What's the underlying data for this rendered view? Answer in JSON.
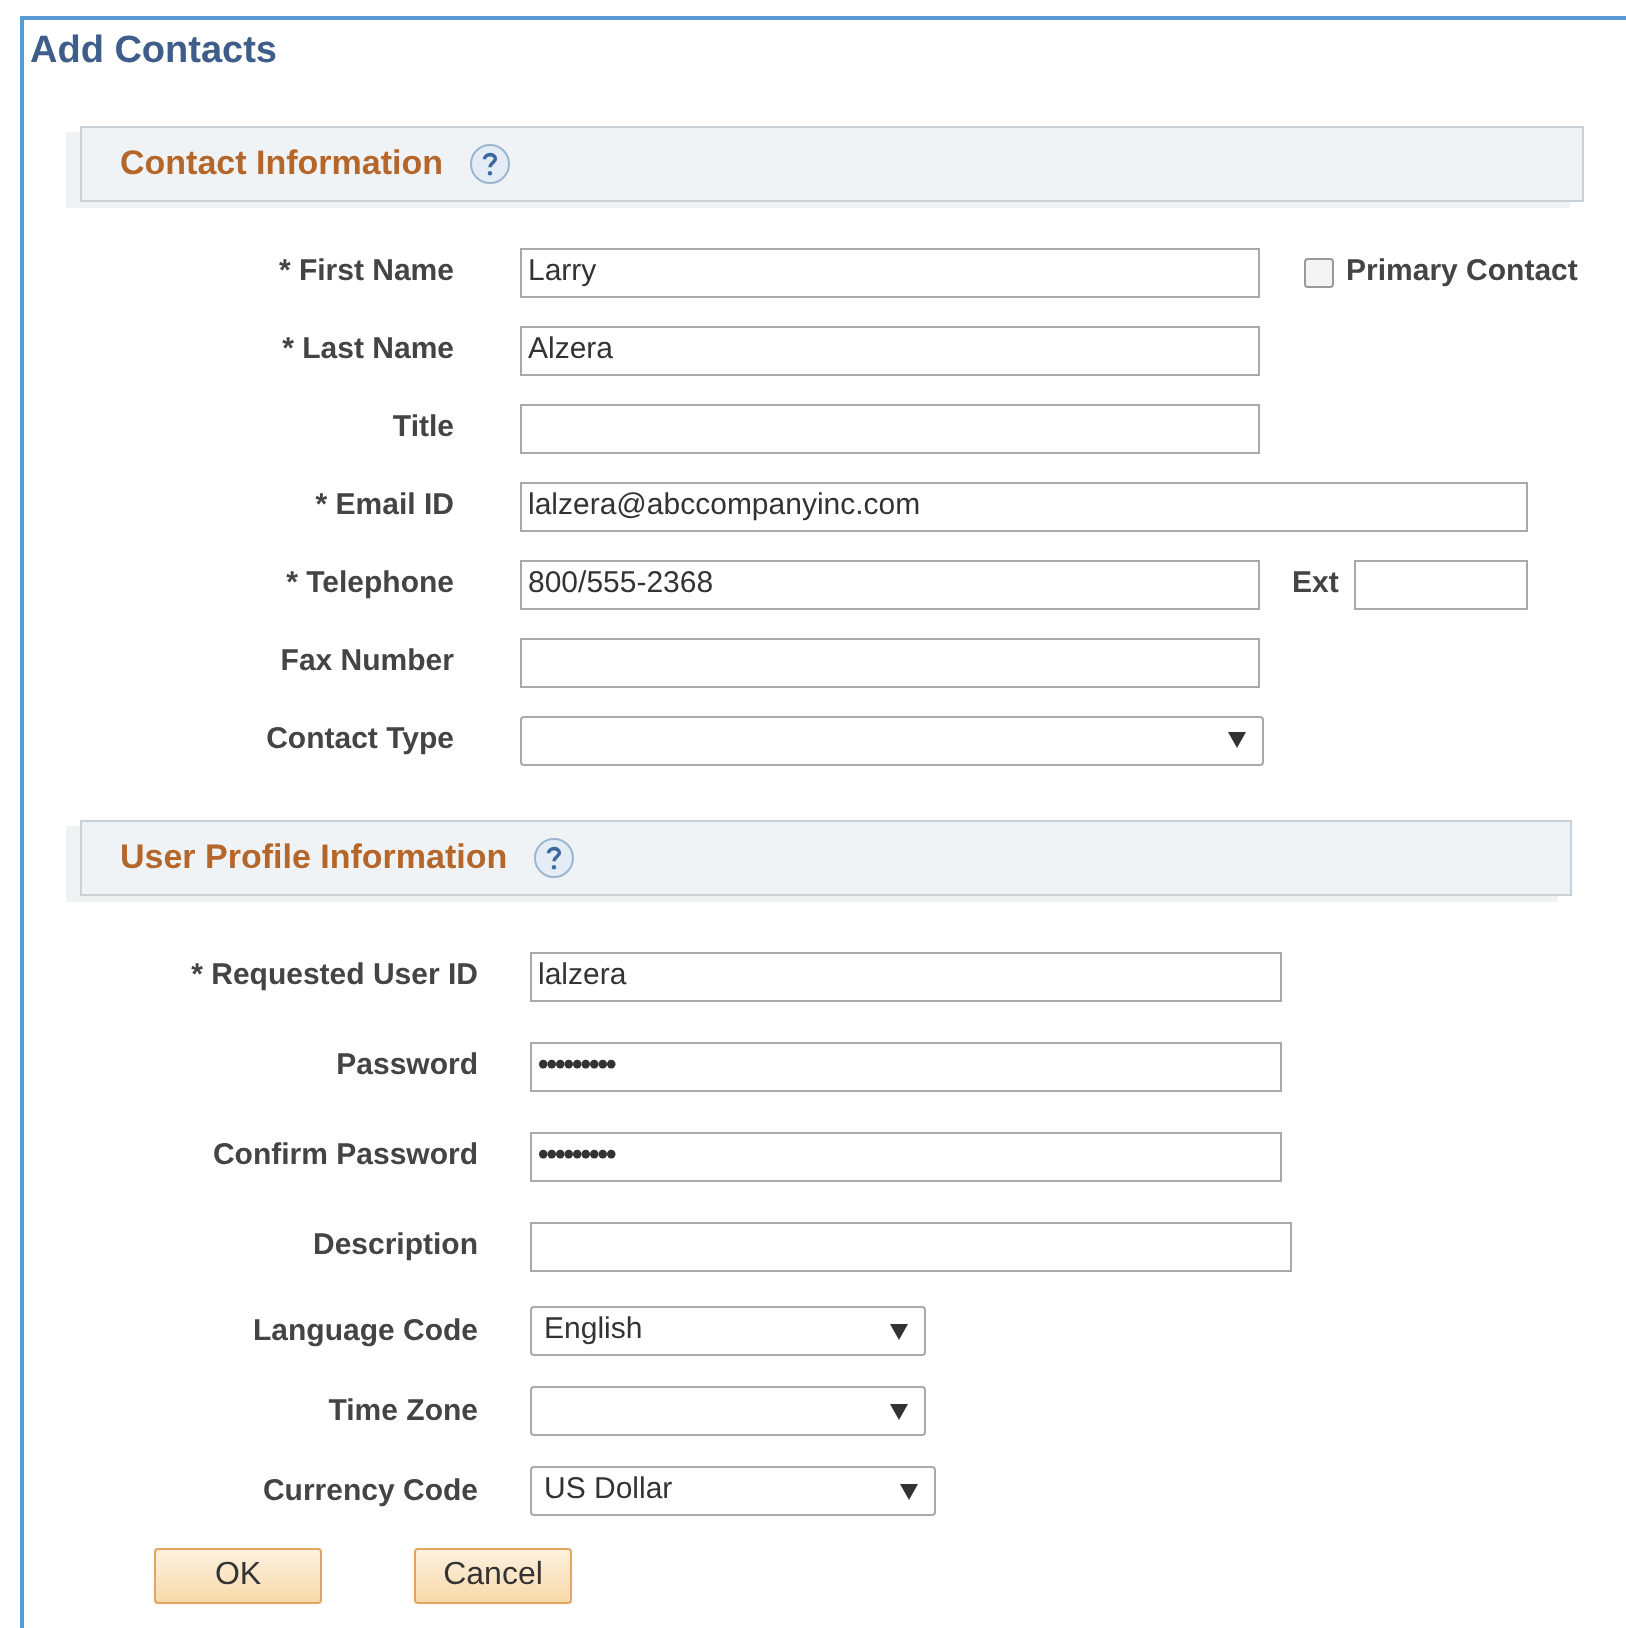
{
  "title": "Add Contacts",
  "sections": [
    {
      "title": "Contact Information",
      "fields": [
        {
          "kind": "text",
          "label": "* First Name",
          "value": "Larry",
          "checkbox": {
            "label": "Primary Contact",
            "checked": false
          }
        },
        {
          "kind": "text",
          "label": "* Last Name",
          "value": "Alzera"
        },
        {
          "kind": "text",
          "label": "Title"
        },
        {
          "kind": "text",
          "label": "* Email ID",
          "value": "lalzera@abccompanyinc.com"
        },
        {
          "kind": "text",
          "label": "* Telephone",
          "value": "800/555-2368",
          "extra": {
            "label": "Ext"
          }
        },
        {
          "kind": "text",
          "label": "Fax Number"
        },
        {
          "kind": "select",
          "label": "Contact Type"
        }
      ]
    },
    {
      "title": "User Profile Information",
      "fields": [
        {
          "kind": "text",
          "label": "* Requested User ID",
          "value": "lalzera"
        },
        {
          "kind": "password",
          "label": "Password",
          "value": "•••••••••"
        },
        {
          "kind": "password",
          "label": "Confirm Password",
          "value": "•••••••••"
        },
        {
          "kind": "text",
          "label": "Description"
        },
        {
          "kind": "select",
          "label": "Language Code",
          "value": "English"
        },
        {
          "kind": "select",
          "label": "Time Zone"
        },
        {
          "kind": "select",
          "label": "Currency Code",
          "value": "US Dollar"
        }
      ]
    }
  ],
  "buttons": [
    "OK",
    "Cancel"
  ]
}
